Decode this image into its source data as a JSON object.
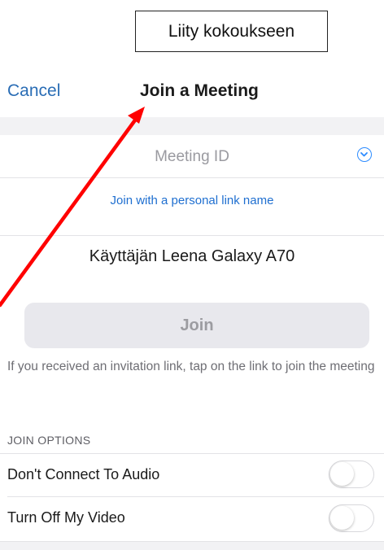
{
  "annotation": {
    "callout_text": "Liity kokoukseen",
    "arrow_color": "#ff0000"
  },
  "nav": {
    "cancel_label": "Cancel",
    "title": "Join a Meeting"
  },
  "meeting_id": {
    "placeholder": "Meeting ID",
    "dropdown_icon": "chevron-down-circle-icon"
  },
  "personal_link_label": "Join with a personal link name",
  "display_name": {
    "value": "Käyttäjän Leena Galaxy A70"
  },
  "join_button_label": "Join",
  "info_text": "If you received an invitation link, tap on the link to join the meeting",
  "join_options": {
    "header": "JOIN OPTIONS",
    "items": [
      {
        "label": "Don't Connect To Audio",
        "on": false
      },
      {
        "label": "Turn Off My Video",
        "on": false
      }
    ]
  },
  "colors": {
    "accent": "#2d8cff",
    "link": "#1f6fd0",
    "background_band": "#f2f2f4",
    "join_button_bg": "#e8e8ed"
  }
}
